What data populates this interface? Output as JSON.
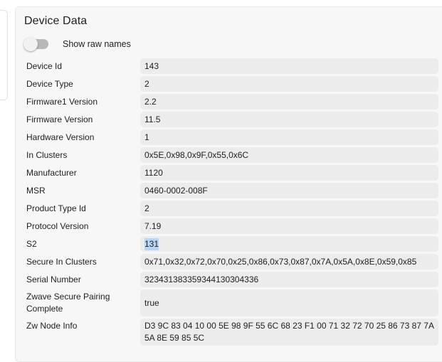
{
  "card": {
    "title": "Device Data",
    "toggle_label": "Show raw names",
    "toggle_on": false
  },
  "rows": [
    {
      "label": "Device Id",
      "value": "143"
    },
    {
      "label": "Device Type",
      "value": "2"
    },
    {
      "label": "Firmware1 Version",
      "value": "2.2"
    },
    {
      "label": "Firmware Version",
      "value": "11.5"
    },
    {
      "label": "Hardware Version",
      "value": "1"
    },
    {
      "label": "In Clusters",
      "value": "0x5E,0x98,0x9F,0x55,0x6C"
    },
    {
      "label": "Manufacturer",
      "value": "1120"
    },
    {
      "label": "MSR",
      "value": "0460-0002-008F"
    },
    {
      "label": "Product Type Id",
      "value": "2"
    },
    {
      "label": "Protocol Version",
      "value": "7.19"
    },
    {
      "label": "S2",
      "value": "131",
      "selected": true
    },
    {
      "label": "Secure In Clusters",
      "value": "0x71,0x32,0x72,0x70,0x25,0x86,0x73,0x87,0x7A,0x5A,0x8E,0x59,0x85"
    },
    {
      "label": "Serial Number",
      "value": "323431383359344130304336"
    },
    {
      "label": "Zwave Secure Pairing Complete",
      "value": "true"
    },
    {
      "label": "Zw Node Info",
      "value": "D3 9C 83 04 10 00 5E 98 9F 55 6C 68 23 F1 00 71 32 72 70 25 86 73 87 7A 5A 8E 59 85 5C"
    }
  ]
}
